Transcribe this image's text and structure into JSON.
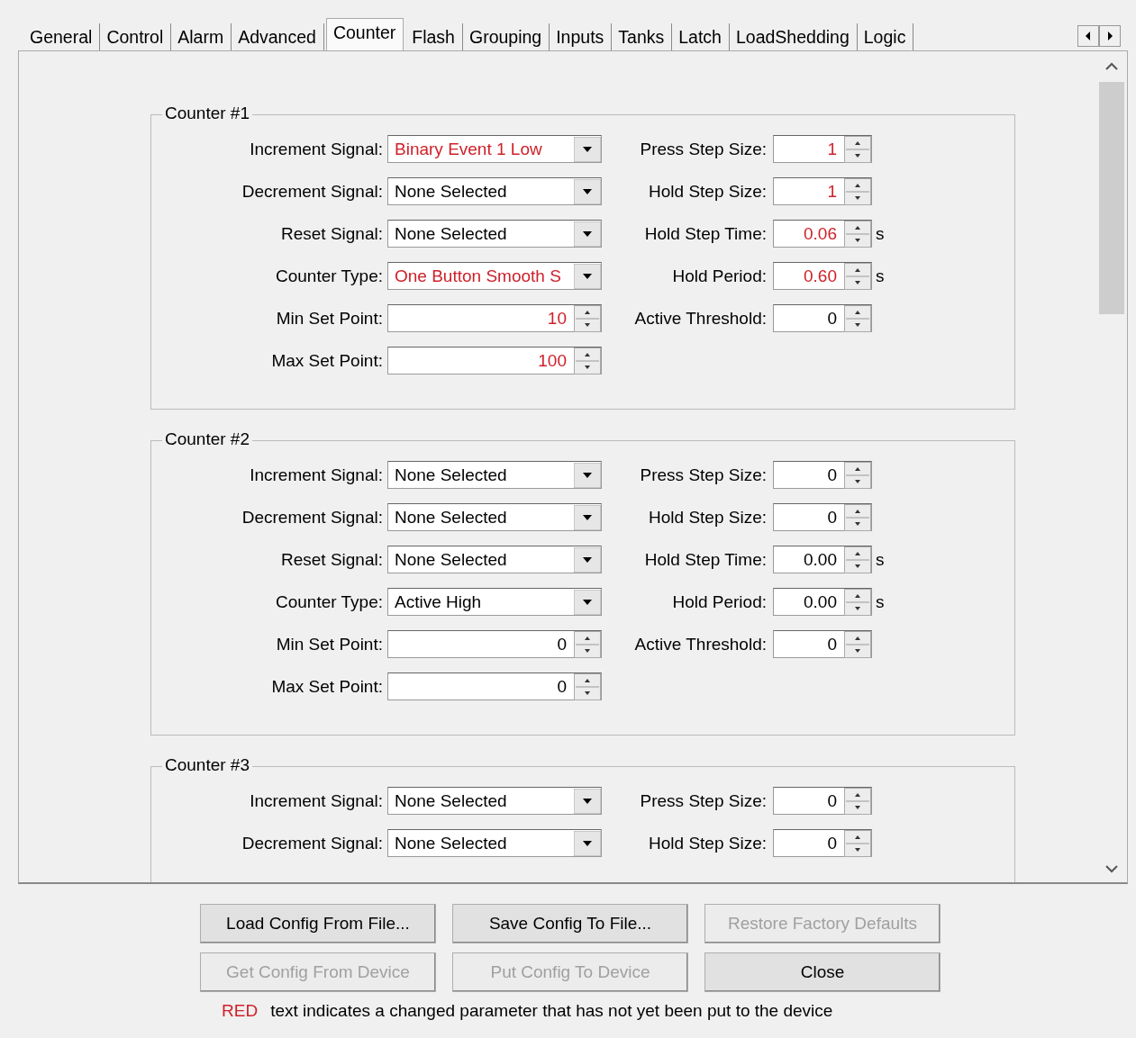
{
  "tabs": [
    {
      "label": "General",
      "selected": false
    },
    {
      "label": "Control",
      "selected": false
    },
    {
      "label": "Alarm",
      "selected": false
    },
    {
      "label": "Advanced",
      "selected": false
    },
    {
      "label": "Counter",
      "selected": true
    },
    {
      "label": "Flash",
      "selected": false
    },
    {
      "label": "Grouping",
      "selected": false
    },
    {
      "label": "Inputs",
      "selected": false
    },
    {
      "label": "Tanks",
      "selected": false
    },
    {
      "label": "Latch",
      "selected": false
    },
    {
      "label": "LoadShedding",
      "selected": false
    },
    {
      "label": "Logic",
      "selected": false
    }
  ],
  "counters": [
    {
      "title": "Counter #1",
      "left_fields": [
        {
          "label": "Increment Signal:",
          "kind": "combo",
          "value": "Binary Event 1 Low",
          "changed": true
        },
        {
          "label": "Decrement Signal:",
          "kind": "combo",
          "value": "None Selected",
          "changed": false
        },
        {
          "label": "Reset Signal:",
          "kind": "combo",
          "value": "None Selected",
          "changed": false
        },
        {
          "label": "Counter Type:",
          "kind": "combo",
          "value": "One Button Smooth S",
          "changed": true
        },
        {
          "label": "Min Set Point:",
          "kind": "spin",
          "value": "10",
          "changed": true
        },
        {
          "label": "Max Set Point:",
          "kind": "spin",
          "value": "100",
          "changed": true
        }
      ],
      "right_fields": [
        {
          "label": "Press Step Size:",
          "kind": "spin",
          "value": "1",
          "changed": true
        },
        {
          "label": "Hold Step Size:",
          "kind": "spin",
          "value": "1",
          "changed": true
        },
        {
          "label": "Hold Step Time:",
          "kind": "spin",
          "value": "0.06",
          "changed": true,
          "unit": "s"
        },
        {
          "label": "Hold Period:",
          "kind": "spin",
          "value": "0.60",
          "changed": true,
          "unit": "s"
        },
        {
          "label": "Active Threshold:",
          "kind": "spin",
          "value": "0",
          "changed": false
        }
      ]
    },
    {
      "title": "Counter #2",
      "left_fields": [
        {
          "label": "Increment Signal:",
          "kind": "combo",
          "value": "None Selected",
          "changed": false
        },
        {
          "label": "Decrement Signal:",
          "kind": "combo",
          "value": "None Selected",
          "changed": false
        },
        {
          "label": "Reset Signal:",
          "kind": "combo",
          "value": "None Selected",
          "changed": false
        },
        {
          "label": "Counter Type:",
          "kind": "combo",
          "value": "Active High",
          "changed": false
        },
        {
          "label": "Min Set Point:",
          "kind": "spin",
          "value": "0",
          "changed": false
        },
        {
          "label": "Max Set Point:",
          "kind": "spin",
          "value": "0",
          "changed": false
        }
      ],
      "right_fields": [
        {
          "label": "Press Step Size:",
          "kind": "spin",
          "value": "0",
          "changed": false
        },
        {
          "label": "Hold Step Size:",
          "kind": "spin",
          "value": "0",
          "changed": false
        },
        {
          "label": "Hold Step Time:",
          "kind": "spin",
          "value": "0.00",
          "changed": false,
          "unit": "s"
        },
        {
          "label": "Hold Period:",
          "kind": "spin",
          "value": "0.00",
          "changed": false,
          "unit": "s"
        },
        {
          "label": "Active Threshold:",
          "kind": "spin",
          "value": "0",
          "changed": false
        }
      ]
    },
    {
      "title": "Counter #3",
      "left_fields": [
        {
          "label": "Increment Signal:",
          "kind": "combo",
          "value": "None Selected",
          "changed": false
        },
        {
          "label": "Decrement Signal:",
          "kind": "combo",
          "value": "None Selected",
          "changed": false
        }
      ],
      "right_fields": [
        {
          "label": "Press Step Size:",
          "kind": "spin",
          "value": "0",
          "changed": false
        },
        {
          "label": "Hold Step Size:",
          "kind": "spin",
          "value": "0",
          "changed": false
        }
      ]
    }
  ],
  "buttons": [
    {
      "label": "Load Config From File...",
      "disabled": false
    },
    {
      "label": "Save Config To File...",
      "disabled": false
    },
    {
      "label": "Restore Factory Defaults",
      "disabled": true
    },
    {
      "label": "Get Config From Device",
      "disabled": true
    },
    {
      "label": "Put Config To Device",
      "disabled": true
    },
    {
      "label": "Close",
      "disabled": false
    }
  ],
  "note": {
    "highlight": "RED",
    "text": "text indicates a changed parameter that has not yet been put to the device"
  }
}
